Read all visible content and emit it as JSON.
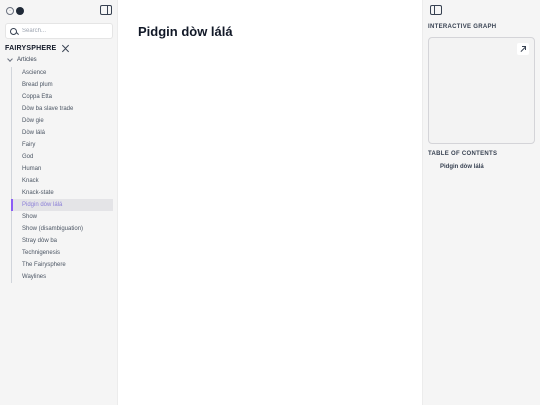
{
  "sidebar": {
    "search_placeholder": "Search...",
    "site_title": "FAIRYSPHERE",
    "tree_root": "Articles",
    "items": [
      {
        "label": "Ascience"
      },
      {
        "label": "Bread plum"
      },
      {
        "label": "Coppa Etta"
      },
      {
        "label": "Dòw ba slave trade"
      },
      {
        "label": "Dòw gie"
      },
      {
        "label": "Dòw lálá"
      },
      {
        "label": "Fairy"
      },
      {
        "label": "God"
      },
      {
        "label": "Human"
      },
      {
        "label": "Knack"
      },
      {
        "label": "Knack-state"
      },
      {
        "label": "Pidgin dòw lálá",
        "active": true
      },
      {
        "label": "Show"
      },
      {
        "label": "Show (disambiguation)"
      },
      {
        "label": "Stray dòw ba"
      },
      {
        "label": "Technigenesis"
      },
      {
        "label": "The Fairysphere"
      },
      {
        "label": "Waylines"
      }
    ]
  },
  "main": {
    "title": "Pidgin dòw lálá"
  },
  "rightbar": {
    "graph_label": "INTERACTIVE GRAPH",
    "toc_label": "TABLE OF CONTENTS",
    "toc_items": [
      "Pidgin dòw lálá"
    ]
  },
  "colors": {
    "accent": "#8b5cf6",
    "active_text": "#8b7fd8",
    "sidebar_bg": "#f5f5f5"
  },
  "icons": [
    "sun-icon",
    "moon-icon",
    "panel-left-icon",
    "search-icon",
    "collapse-icon",
    "chevron-down-icon",
    "panel-right-icon",
    "expand-icon"
  ]
}
